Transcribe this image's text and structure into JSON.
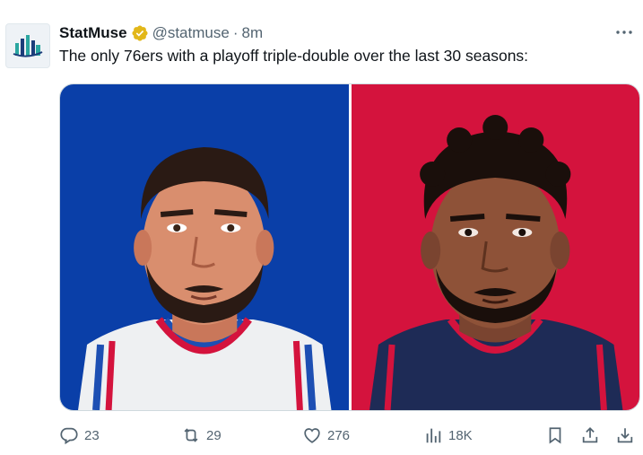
{
  "tweet": {
    "display_name": "StatMuse",
    "handle": "@statmuse",
    "dot": "·",
    "time": "8m",
    "text": "The only 76ers with a playoff triple-double over the last 30 seasons:",
    "verified_color": "#e2b719",
    "more_icon": "ellipsis-icon"
  },
  "actions": {
    "replies": "23",
    "reposts": "29",
    "likes": "276",
    "views": "18K"
  },
  "colors": {
    "panel_left": "#0a3fa8",
    "panel_right": "#d4133d",
    "text_muted": "#536471",
    "logo_teal": "#2aa6a0",
    "logo_navy": "#1c3d7a"
  }
}
